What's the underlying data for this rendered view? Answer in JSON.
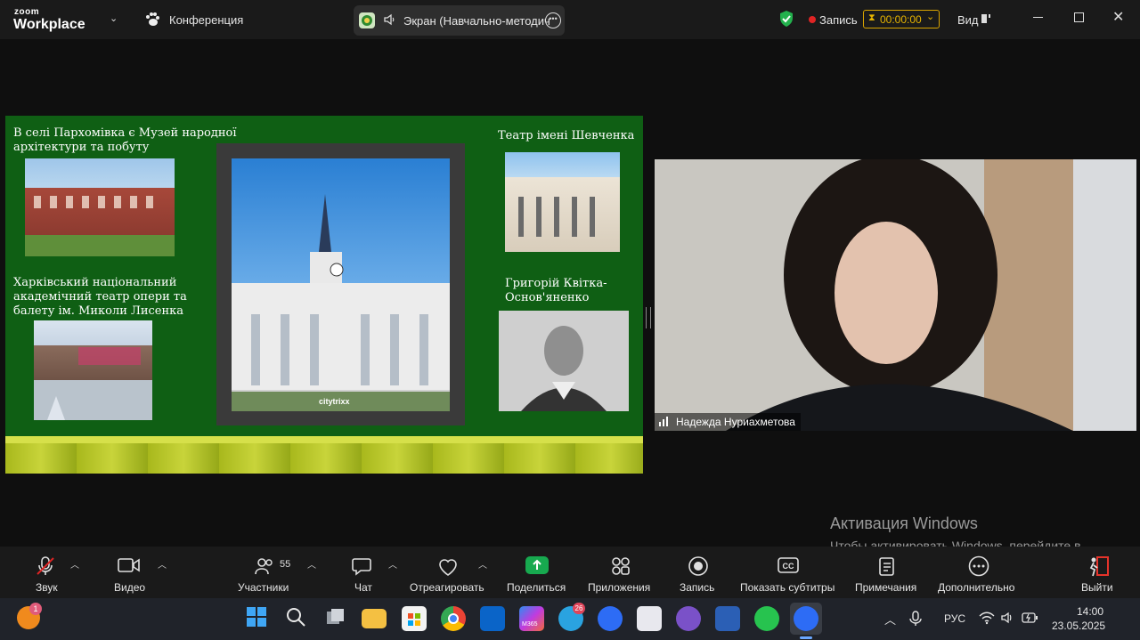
{
  "app": {
    "logo_line1": "zoom",
    "logo_line2": "Workplace",
    "conference_label": "Конференция"
  },
  "share": {
    "label": "Экран (Навчально-методич"
  },
  "titlebar": {
    "record_label": "Запись",
    "record_time": "00:00:00",
    "view_label": "Вид"
  },
  "slide": {
    "museum_text": "В селі Пархомівка є Музей народної архітектури та побуту",
    "opera_text": "Харківський національний академічний театр опери та балету ім. Миколи Лисенка",
    "theatre_text": "Театр імені Шевченка",
    "kvitka_text": "Григорій Квітка-Основ'яненко",
    "watermark": "citytrixx"
  },
  "video": {
    "participant_name": "Надежда Нуриахметова"
  },
  "activation": {
    "title": "Активация Windows",
    "subtitle": "Чтобы активировать Windows, перейдите в раздел \"Параметры\"."
  },
  "toolbar": {
    "audio": "Звук",
    "video": "Видео",
    "participants": "Участники",
    "participants_count": "55",
    "chat": "Чат",
    "react": "Отреагировать",
    "share": "Поделиться",
    "apps": "Приложения",
    "record": "Запись",
    "captions": "Показать субтитры",
    "notes": "Примечания",
    "more": "Дополнительно",
    "leave": "Выйти"
  },
  "taskbar": {
    "lang": "РУС",
    "time": "14:00",
    "date": "23.05.2025",
    "notification_badge": "1",
    "telegram_badge": "26",
    "m365_label": "M365"
  },
  "colors": {
    "share_green": "#17a94f",
    "record_red": "#e02424",
    "leave_red": "#e5332a",
    "slide_green": "#0f5f14"
  }
}
